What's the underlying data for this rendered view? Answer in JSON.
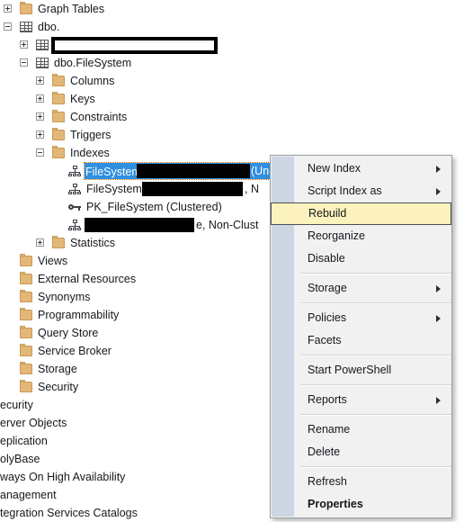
{
  "tree": {
    "items": [
      {
        "label": "Graph Tables",
        "icon": "folder-icon",
        "indent": 0,
        "expander": "plus"
      },
      {
        "label": "dbo.",
        "icon": "table-icon",
        "indent": 0,
        "expander": "minus"
      },
      {
        "label": "",
        "icon": "table-icon",
        "indent": 1,
        "expander": "plus",
        "redacted": "hollow"
      },
      {
        "label": "dbo.FileSystem",
        "icon": "table-icon",
        "indent": 1,
        "expander": "minus"
      },
      {
        "label": "Columns",
        "icon": "folder-icon",
        "indent": 2,
        "expander": "plus"
      },
      {
        "label": "Keys",
        "icon": "folder-icon",
        "indent": 2,
        "expander": "plus"
      },
      {
        "label": "Constraints",
        "icon": "folder-icon",
        "indent": 2,
        "expander": "plus"
      },
      {
        "label": "Triggers",
        "icon": "folder-icon",
        "indent": 2,
        "expander": "plus"
      },
      {
        "label": "Indexes",
        "icon": "folder-icon",
        "indent": 2,
        "expander": "minus"
      },
      {
        "label": "FileSystem",
        "icon": "index-icon",
        "indent": 3,
        "selected": true,
        "suffix": "(Unique, Non-Clustered)"
      },
      {
        "label": "FileSystem_",
        "icon": "index-icon",
        "indent": 3,
        "suffix": ", N"
      },
      {
        "label": "PK_FileSystem (Clustered)",
        "icon": "key-icon",
        "indent": 3
      },
      {
        "label": "",
        "icon": "index-icon",
        "indent": 3,
        "suffix": "e, Non-Clust"
      },
      {
        "label": "Statistics",
        "icon": "folder-icon",
        "indent": 2,
        "expander": "plus"
      },
      {
        "label": "Views",
        "icon": "folder-icon",
        "indent": 0
      },
      {
        "label": "External Resources",
        "icon": "folder-icon",
        "indent": 0
      },
      {
        "label": "Synonyms",
        "icon": "folder-icon",
        "indent": 0
      },
      {
        "label": "Programmability",
        "icon": "folder-icon",
        "indent": 0
      },
      {
        "label": "Query Store",
        "icon": "folder-icon",
        "indent": 0
      },
      {
        "label": "Service Broker",
        "icon": "folder-icon",
        "indent": 0
      },
      {
        "label": "Storage",
        "icon": "folder-icon",
        "indent": 0
      },
      {
        "label": "Security",
        "icon": "folder-icon",
        "indent": 0
      },
      {
        "label": "ecurity",
        "clipped": true
      },
      {
        "label": "erver Objects",
        "clipped": true
      },
      {
        "label": "eplication",
        "clipped": true
      },
      {
        "label": "olyBase",
        "clipped": true
      },
      {
        "label": "ways On High Availability",
        "clipped": true
      },
      {
        "label": "anagement",
        "clipped": true
      },
      {
        "label": "tegration Services Catalogs",
        "clipped": true
      }
    ]
  },
  "context_menu": {
    "items": [
      {
        "label": "New Index",
        "submenu": true
      },
      {
        "label": "Script Index as",
        "submenu": true
      },
      {
        "label": "Rebuild",
        "highlighted": true
      },
      {
        "label": "Reorganize"
      },
      {
        "label": "Disable"
      },
      {
        "separator": true
      },
      {
        "label": "Storage",
        "submenu": true
      },
      {
        "separator": true
      },
      {
        "label": "Policies",
        "submenu": true
      },
      {
        "label": "Facets"
      },
      {
        "separator": true
      },
      {
        "label": "Start PowerShell"
      },
      {
        "separator": true
      },
      {
        "label": "Reports",
        "submenu": true
      },
      {
        "separator": true
      },
      {
        "label": "Rename"
      },
      {
        "label": "Delete"
      },
      {
        "separator": true
      },
      {
        "label": "Refresh"
      },
      {
        "label": "Properties",
        "bold": true
      }
    ]
  },
  "colors": {
    "selection_blue": "#2f8fe0",
    "highlight_yellow": "#fcf2bd",
    "menu_background": "#f1f1f1",
    "menu_gutter": "#cdd6e3",
    "folder_icon": "#e3b778",
    "redaction": "#000000"
  }
}
